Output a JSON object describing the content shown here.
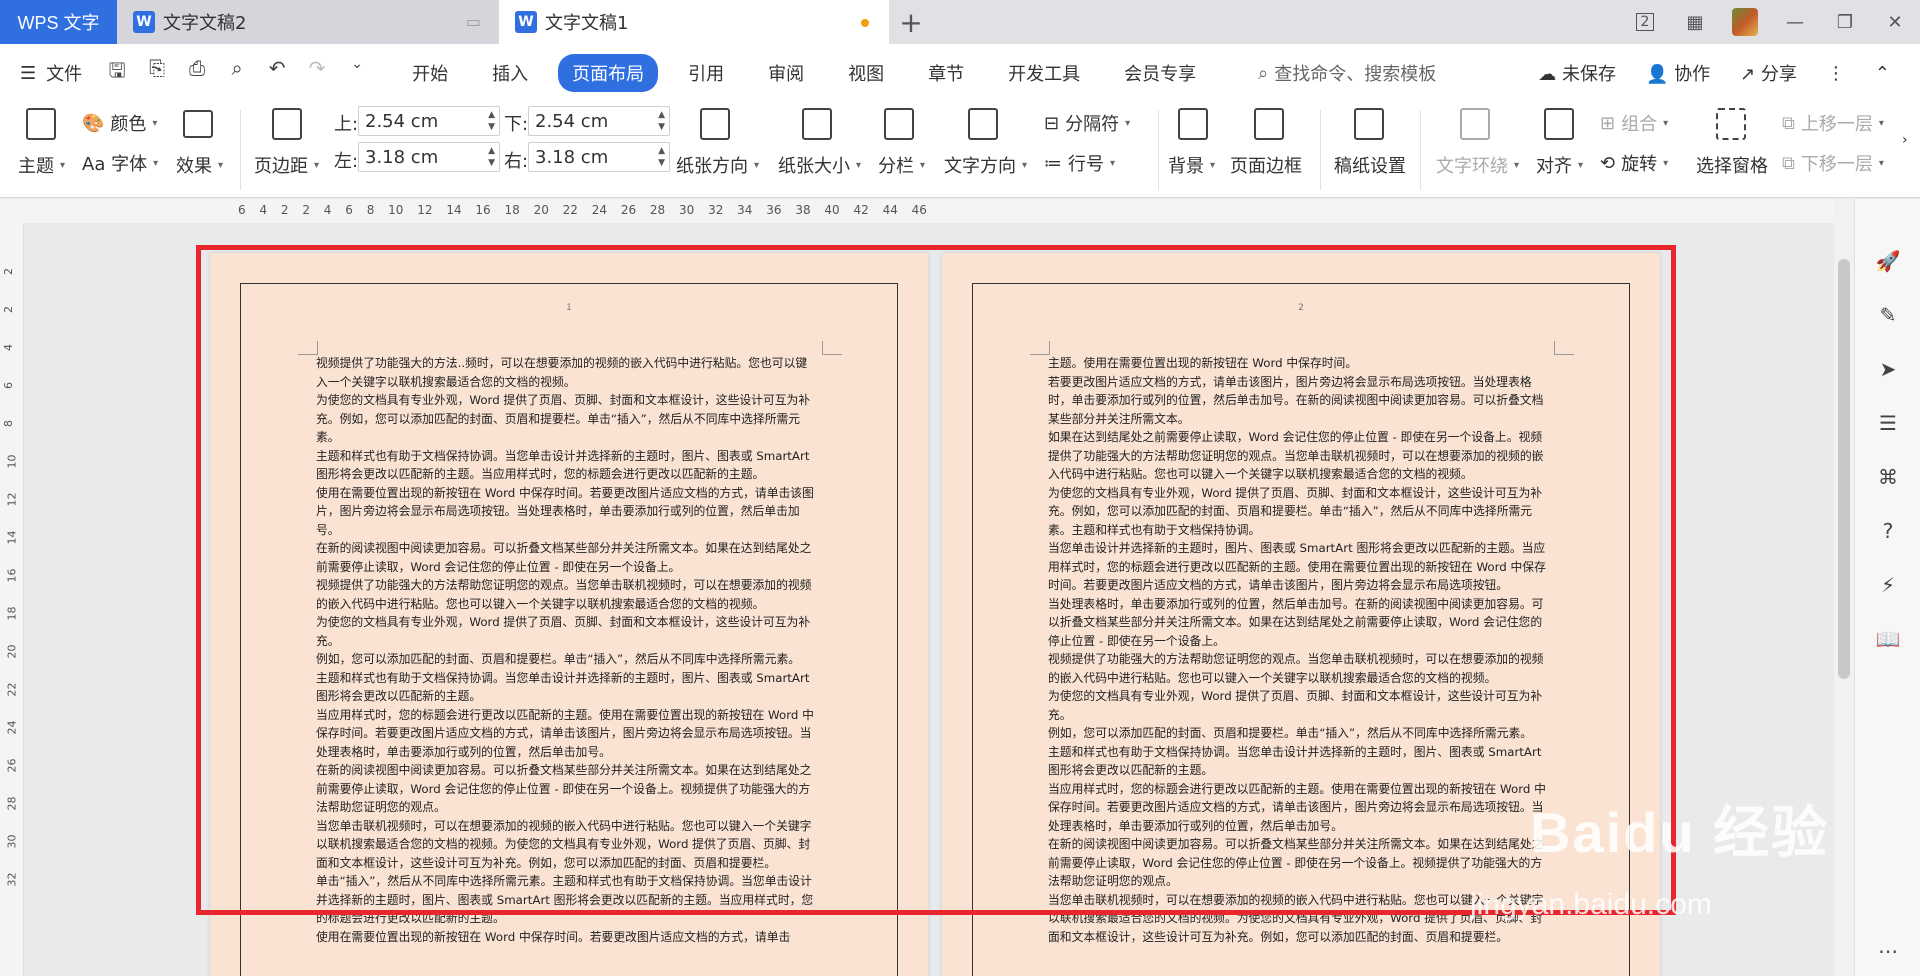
{
  "titlebar": {
    "app_name": "WPS 文字",
    "tabs": [
      {
        "label": "文字文稿2"
      },
      {
        "label": "文字文稿1"
      }
    ],
    "newtab": "+",
    "badge": "2"
  },
  "menubar": {
    "file": "文件",
    "items": [
      "开始",
      "插入",
      "页面布局",
      "引用",
      "审阅",
      "视图",
      "章节",
      "开发工具",
      "会员专享"
    ],
    "search": "查找命令、搜索模板",
    "unsaved": "未保存",
    "collab": "协作",
    "share": "分享"
  },
  "ribbon": {
    "theme": "主题",
    "color": "颜色",
    "font": "Aa 字体",
    "effect": "效果",
    "margins": "页边距",
    "top_label": "上:",
    "top_value": "2.54 cm",
    "bottom_label": "下:",
    "bottom_value": "2.54 cm",
    "left_label": "左:",
    "left_value": "3.18 cm",
    "right_label": "右:",
    "right_value": "3.18 cm",
    "orientation": "纸张方向",
    "size": "纸张大小",
    "columns": "分栏",
    "text_direction": "文字方向",
    "separator": "分隔符",
    "line_number": "行号",
    "background": "背景",
    "page_border": "页面边框",
    "manuscript": "稿纸设置",
    "wrap": "文字环绕",
    "align": "对齐",
    "group": "组合",
    "rotate": "旋转",
    "selection_pane": "选择窗格",
    "bring_forward": "上移一层",
    "send_backward": "下移一层"
  },
  "ruler": {
    "h_numbers": "6 4 2 2 4 6 8 10 12 14 16 18 20 22 24 26 28 30 32 34 36 38 40 42 44 46",
    "v_numbers": [
      "2",
      "2",
      "4",
      "6",
      "8",
      "10",
      "12",
      "14",
      "16",
      "18",
      "20",
      "22",
      "24",
      "26",
      "28",
      "30",
      "32"
    ]
  },
  "pages": [
    {
      "number": "1",
      "text": "视频提供了功能强大的方法..频时，可以在想要添加的视频的嵌入代码中进行粘贴。您也可以键入一个关键字以联机搜索最适合您的文档的视频。\n为使您的文档具有专业外观，Word 提供了页眉、页脚、封面和文本框设计，这些设计可互为补充。例如，您可以添加匹配的封面、页眉和提要栏。单击“插入”，然后从不同库中选择所需元素。\n主题和样式也有助于文档保持协调。当您单击设计并选择新的主题时，图片、图表或 SmartArt 图形将会更改以匹配新的主题。当应用样式时，您的标题会进行更改以匹配新的主题。\n使用在需要位置出现的新按钮在 Word 中保存时间。若要更改图片适应文档的方式，请单击该图片，图片旁边将会显示布局选项按钮。当处理表格时，单击要添加行或列的位置，然后单击加号。\n在新的阅读视图中阅读更加容易。可以折叠文档某些部分并关注所需文本。如果在达到结尾处之前需要停止读取，Word 会记住您的停止位置 - 即使在另一个设备上。\n视频提供了功能强大的方法帮助您证明您的观点。当您单击联机视频时，可以在想要添加的视频的嵌入代码中进行粘贴。您也可以键入一个关键字以联机搜索最适合您的文档的视频。\n为使您的文档具有专业外观，Word 提供了页眉、页脚、封面和文本框设计，这些设计可互为补充。\n例如，您可以添加匹配的封面、页眉和提要栏。单击“插入”，然后从不同库中选择所需元素。\n主题和样式也有助于文档保持协调。当您单击设计并选择新的主题时，图片、图表或 SmartArt 图形将会更改以匹配新的主题。\n当应用样式时，您的标题会进行更改以匹配新的主题。使用在需要位置出现的新按钮在 Word 中保存时间。若要更改图片适应文档的方式，请单击该图片，图片旁边将会显示布局选项按钮。当处理表格时，单击要添加行或列的位置，然后单击加号。\n在新的阅读视图中阅读更加容易。可以折叠文档某些部分并关注所需文本。如果在达到结尾处之前需要停止读取，Word 会记住您的停止位置 - 即使在另一个设备上。视频提供了功能强大的方法帮助您证明您的观点。\n当您单击联机视频时，可以在想要添加的视频的嵌入代码中进行粘贴。您也可以键入一个关键字以联机搜索最适合您的文档的视频。为使您的文档具有专业外观，Word 提供了页眉、页脚、封面和文本框设计，这些设计可互为补充。例如，您可以添加匹配的封面、页眉和提要栏。\n单击“插入”，然后从不同库中选择所需元素。主题和样式也有助于文档保持协调。当您单击设计并选择新的主题时，图片、图表或 SmartArt 图形将会更改以匹配新的主题。当应用样式时，您的标题会进行更改以匹配新的主题。\n使用在需要位置出现的新按钮在 Word 中保存时间。若要更改图片适应文档的方式，请单击"
    },
    {
      "number": "2",
      "text": "主题。使用在需要位置出现的新按钮在 Word 中保存时间。\n若要更改图片适应文档的方式，请单击该图片，图片旁边将会显示布局选项按钮。当处理表格时，单击要添加行或列的位置，然后单击加号。在新的阅读视图中阅读更加容易。可以折叠文档某些部分并关注所需文本。\n如果在达到结尾处之前需要停止读取，Word 会记住您的停止位置 - 即使在另一个设备上。视频提供了功能强大的方法帮助您证明您的观点。当您单击联机视频时，可以在想要添加的视频的嵌入代码中进行粘贴。您也可以键入一个关键字以联机搜索最适合您的文档的视频。\n为使您的文档具有专业外观，Word 提供了页眉、页脚、封面和文本框设计，这些设计可互为补充。例如，您可以添加匹配的封面、页眉和提要栏。单击“插入”，然后从不同库中选择所需元素。主题和样式也有助于文档保持协调。\n当您单击设计并选择新的主题时，图片、图表或 SmartArt 图形将会更改以匹配新的主题。当应用样式时，您的标题会进行更改以匹配新的主题。使用在需要位置出现的新按钮在 Word 中保存时间。若要更改图片适应文档的方式，请单击该图片，图片旁边将会显示布局选项按钮。\n当处理表格时，单击要添加行或列的位置，然后单击加号。在新的阅读视图中阅读更加容易。可以折叠文档某些部分并关注所需文本。如果在达到结尾处之前需要停止读取，Word 会记住您的停止位置 - 即使在另一个设备上。\n视频提供了功能强大的方法帮助您证明您的观点。当您单击联机视频时，可以在想要添加的视频的嵌入代码中进行粘贴。您也可以键入一个关键字以联机搜索最适合您的文档的视频。\n为使您的文档具有专业外观，Word 提供了页眉、页脚、封面和文本框设计，这些设计可互为补充。\n例如，您可以添加匹配的封面、页眉和提要栏。单击“插入”，然后从不同库中选择所需元素。\n主题和样式也有助于文档保持协调。当您单击设计并选择新的主题时，图片、图表或 SmartArt 图形将会更改以匹配新的主题。\n当应用样式时，您的标题会进行更改以匹配新的主题。使用在需要位置出现的新按钮在 Word 中保存时间。若要更改图片适应文档的方式，请单击该图片，图片旁边将会显示布局选项按钮。当处理表格时，单击要添加行或列的位置，然后单击加号。\n在新的阅读视图中阅读更加容易。可以折叠文档某些部分并关注所需文本。如果在达到结尾处之前需要停止读取，Word 会记住您的停止位置 - 即使在另一个设备上。视频提供了功能强大的方法帮助您证明您的观点。\n当您单击联机视频时，可以在想要添加的视频的嵌入代码中进行粘贴。您也可以键入一个关键字以联机搜索最适合您的文档的视频。为使您的文档具有专业外观，Word 提供了页眉、页脚、封面和文本框设计，这些设计可互为补充。例如，您可以添加匹配的封面、页眉和提要栏。"
    }
  ],
  "watermark": {
    "main": "Baidu 经验",
    "sub": "jingyan.baidu.com"
  },
  "colors": {
    "accent": "#2f6fe0",
    "page_bg": "#fbe3d3",
    "highlight": "#e8262d"
  }
}
